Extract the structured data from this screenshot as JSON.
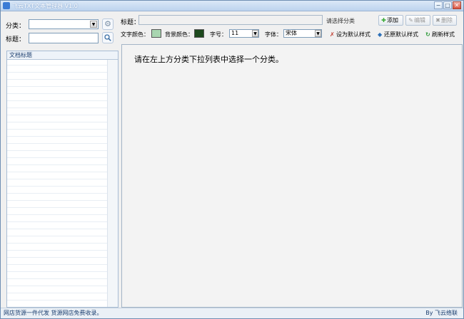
{
  "window": {
    "title": "飞云TXT文本管理器 V1.0",
    "min_label": "−",
    "max_label": "□",
    "close_label": "✕"
  },
  "left_panel": {
    "category_label": "分类：",
    "category_value": "",
    "title_label": "标题：",
    "title_value": "",
    "list_header": "文档标题"
  },
  "right_panel": {
    "title_label": "标题：",
    "title_value": "",
    "hint": "请选择分类",
    "buttons": {
      "add": "添加",
      "edit": "编辑",
      "delete": "删除"
    },
    "text_color_label": "文字颜色：",
    "text_color": "#a8d5b0",
    "bg_color_label": "背景颜色：",
    "bg_color": "#1e4a1e",
    "font_size_label": "字号：",
    "font_size_value": "11",
    "font_family_label": "字体：",
    "font_family_value": "宋体",
    "set_default": "设为默认样式",
    "restore_default": "还原默认样式",
    "refresh_style": "刷新样式",
    "content_message": "请在左上方分类下拉列表中选择一个分类。"
  },
  "statusbar": {
    "left": "网店货源一件代发 货源网店免费收录。",
    "right": "By 飞云络联"
  },
  "icons": {
    "gear": "⚙",
    "search": "🔍"
  }
}
